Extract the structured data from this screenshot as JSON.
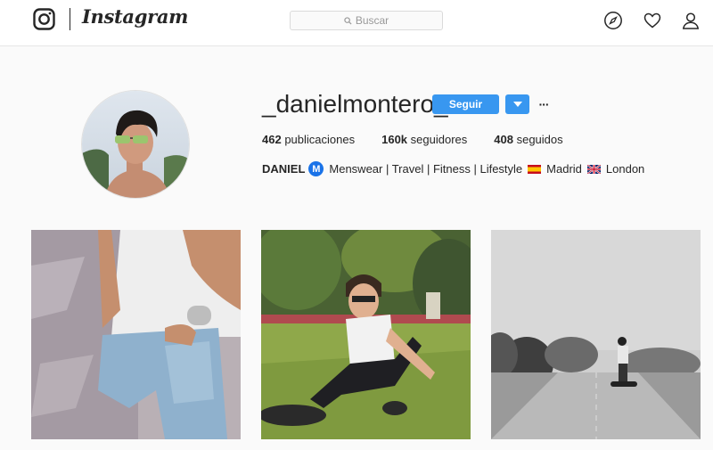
{
  "nav": {
    "wordmark": "Instagram",
    "search_placeholder": "Buscar",
    "icons": [
      "instagram-logo-icon",
      "search-icon",
      "compass-icon",
      "heart-icon",
      "person-icon"
    ]
  },
  "profile": {
    "username": "_danielmontero_",
    "follow_label": "Seguir",
    "more_label": "···",
    "stats": {
      "posts_count": "462",
      "posts_label": "publicaciones",
      "followers_count": "160k",
      "followers_label": "seguidores",
      "following_count": "408",
      "following_label": "seguidos"
    },
    "bio": {
      "name": "DANIEL",
      "badge": "M",
      "text": "Menswear | Travel | Fitness | Lifestyle",
      "city1": "Madrid",
      "city2": "London"
    }
  },
  "posts": [
    {
      "label": "post-denim-shorts"
    },
    {
      "label": "post-park-sitting"
    },
    {
      "label": "post-hoverboard-bw"
    }
  ],
  "colors": {
    "accent": "#3897f0",
    "text": "#262626",
    "background": "#fafafa"
  }
}
